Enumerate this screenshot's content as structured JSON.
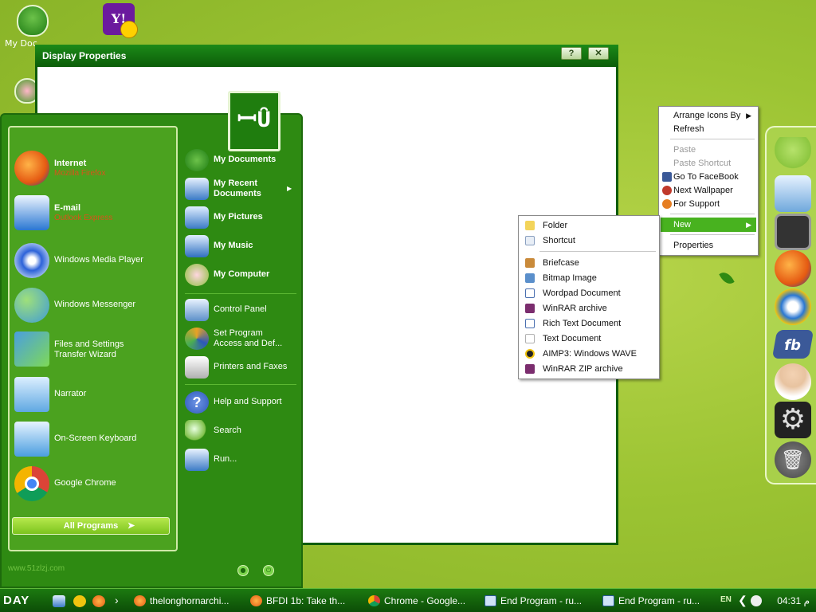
{
  "desktop": {
    "icons": [
      {
        "label": "My Doc",
        "icon": "my-documents-cup-icon"
      },
      {
        "label": "",
        "icon": "yahoo-messenger-icon"
      },
      {
        "label": "",
        "icon": "flower-cup-icon"
      }
    ]
  },
  "window": {
    "title": "Display Properties",
    "help_glyph": "?",
    "close_glyph": "✕"
  },
  "start_menu": {
    "logo_text": "ꟷȖ",
    "left_items": [
      {
        "title": "Internet",
        "subtitle": "Mozilla Firefox",
        "icon": "firefox-icon",
        "color": "#e55a12"
      },
      {
        "title": "E-mail",
        "subtitle": "Outlook Express",
        "icon": "outlook-express-icon",
        "color": "#2a77d2"
      },
      {
        "title": "Windows Media Player",
        "icon": "media-player-icon",
        "color": "#2d62d9"
      },
      {
        "title": "Windows Messenger",
        "icon": "messenger-icon",
        "color": "#3f9bd6"
      },
      {
        "title": "Files and Settings",
        "title2": "Transfer Wizard",
        "icon": "transfer-wizard-icon",
        "color": "#4a9ee0"
      },
      {
        "title": "Narrator",
        "icon": "narrator-icon",
        "color": "#5fa8e2"
      },
      {
        "title": "On-Screen Keyboard",
        "icon": "keyboard-icon",
        "color": "#4a9ee0"
      },
      {
        "title": "Google Chrome",
        "icon": "chrome-icon",
        "color": "#db4437"
      }
    ],
    "right_items": [
      {
        "label": "My Documents",
        "bold": true,
        "icon": "cup-icon",
        "color": "#1f7d14"
      },
      {
        "label": "My Recent",
        "label2": "Documents",
        "bold": true,
        "icon": "recent-docs-icon",
        "color": "#3b7bc6",
        "submenu": "▶"
      },
      {
        "label": "My Pictures",
        "bold": true,
        "icon": "pictures-monitor-icon",
        "color": "#3b7bc6"
      },
      {
        "label": "My Music",
        "bold": true,
        "icon": "music-icon",
        "color": "#2f6fc0"
      },
      {
        "label": "My Computer",
        "bold": true,
        "icon": "computer-flower-icon",
        "color": "#8bbf3a"
      },
      {
        "label": "Control Panel",
        "icon": "control-panel-icon",
        "color": "#5b8fc8"
      },
      {
        "label": "Set Program",
        "label2": "Access and Def...",
        "icon": "program-access-icon",
        "color": "#e9a225"
      },
      {
        "label": "Printers and Faxes",
        "icon": "printer-icon",
        "color": "#e0e0e0"
      },
      {
        "label": "Help and Support",
        "icon": "help-icon",
        "color": "#2c58b8"
      },
      {
        "label": "Search",
        "icon": "search-icon",
        "color": "#7fbf4a"
      },
      {
        "label": "Run...",
        "icon": "run-icon",
        "color": "#3b7bc6"
      }
    ],
    "all_programs": "All Programs",
    "footer": "www.51zlzj.com"
  },
  "context_menu": {
    "items": [
      {
        "label": "Arrange Icons By",
        "arrow": "▶"
      },
      {
        "label": "Refresh"
      },
      {
        "label": "Paste",
        "disabled": true
      },
      {
        "label": "Paste Shortcut",
        "disabled": true
      },
      {
        "label": "Go To FaceBook",
        "icon": "facebook-icon",
        "color": "#3b5998"
      },
      {
        "label": "Next Wallpaper",
        "icon": "next-wallpaper-icon",
        "color": "#c0392b"
      },
      {
        "label": "For Support",
        "icon": "support-icon",
        "color": "#e67e22"
      },
      {
        "label": "New",
        "arrow": "▶",
        "selected": true
      },
      {
        "label": "Properties"
      }
    ]
  },
  "new_submenu": {
    "items": [
      {
        "label": "Folder",
        "icon": "folder-icon",
        "color": "#f3d45a"
      },
      {
        "label": "Shortcut",
        "icon": "shortcut-icon",
        "color": "#e8eef6"
      },
      {
        "label": "Briefcase",
        "icon": "briefcase-icon",
        "color": "#c98a3a"
      },
      {
        "label": "Bitmap Image",
        "icon": "bitmap-icon",
        "color": "#5a8fcb"
      },
      {
        "label": "Wordpad Document",
        "icon": "wordpad-icon",
        "color": "#4a6fb0"
      },
      {
        "label": "WinRAR archive",
        "icon": "winrar-icon",
        "color": "#7b2d6e"
      },
      {
        "label": "Rich Text Document",
        "icon": "rtf-icon",
        "color": "#4a6fb0"
      },
      {
        "label": "Text Document",
        "icon": "text-doc-icon",
        "color": "#eeeeee"
      },
      {
        "label": "AIMP3: Windows WAVE",
        "icon": "aimp-icon",
        "color": "#222222"
      },
      {
        "label": "WinRAR ZIP archive",
        "icon": "winrar-zip-icon",
        "color": "#7b2d6e"
      }
    ]
  },
  "dock": {
    "items": [
      {
        "icon": "android-icon",
        "color": "#8cc63f"
      },
      {
        "icon": "network-monitor-icon",
        "color": "#6fa8dc"
      },
      {
        "icon": "ipad-icon",
        "color": "#333333"
      },
      {
        "icon": "firefox-icon",
        "color": "#e55a12"
      },
      {
        "icon": "internet-explorer-icon",
        "color": "#2a77d2"
      },
      {
        "icon": "facebook-icon",
        "color": "#3b5998",
        "text": "fb"
      },
      {
        "icon": "support-agent-icon",
        "color": "#e8c3a0"
      },
      {
        "icon": "settings-gear-icon",
        "color": "#555555"
      },
      {
        "icon": "trash-icon",
        "color": "#666666"
      }
    ]
  },
  "taskbar": {
    "start_label": "DAY",
    "chevron": "›",
    "tasks": [
      {
        "label": "thelonghornarchi...",
        "icon": "firefox-icon",
        "color": "#e55a12"
      },
      {
        "label": "BFDI 1b: Take th...",
        "icon": "firefox-icon",
        "color": "#e55a12"
      },
      {
        "label": "Chrome - Google...",
        "icon": "chrome-icon",
        "color": "#db4437"
      },
      {
        "label": "End Program - ru...",
        "icon": "window-icon",
        "color": "#cfe3f7"
      },
      {
        "label": "End Program - ru...",
        "icon": "window-icon",
        "color": "#cfe3f7"
      }
    ],
    "tray": {
      "lang": "EN",
      "time": "04:31 م"
    }
  }
}
